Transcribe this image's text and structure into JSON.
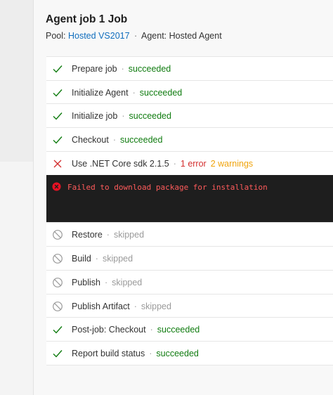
{
  "job": {
    "title": "Agent job 1 Job",
    "pool_label": "Pool:",
    "pool_value": "Hosted VS2017",
    "agent_text": "Agent: Hosted Agent"
  },
  "steps": [
    {
      "name": "Prepare job",
      "status": "succeeded",
      "state": "success"
    },
    {
      "name": "Initialize Agent",
      "status": "succeeded",
      "state": "success"
    },
    {
      "name": "Initialize job",
      "status": "succeeded",
      "state": "success"
    },
    {
      "name": "Checkout",
      "status": "succeeded",
      "state": "success"
    },
    {
      "name": "Use .NET Core sdk 2.1.5",
      "errors": "1 error",
      "warnings": "2 warnings",
      "state": "failed"
    },
    {
      "name": "Restore",
      "status": "skipped",
      "state": "skipped"
    },
    {
      "name": "Build",
      "status": "skipped",
      "state": "skipped"
    },
    {
      "name": "Publish",
      "status": "skipped",
      "state": "skipped"
    },
    {
      "name": "Publish Artifact",
      "status": "skipped",
      "state": "skipped"
    },
    {
      "name": "Post-job: Checkout",
      "status": "succeeded",
      "state": "success"
    },
    {
      "name": "Report build status",
      "status": "succeeded",
      "state": "success"
    }
  ],
  "log": {
    "message": "Failed to download package for installation"
  },
  "separator": "·",
  "colors": {
    "success": "#107c10",
    "error": "#d32f2f",
    "warning": "#f0a30a",
    "skipped": "#9a9a9a",
    "link": "#106ebe",
    "log_bg": "#1e1e1e"
  }
}
